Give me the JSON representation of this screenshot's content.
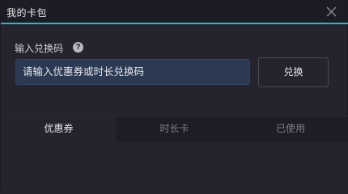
{
  "window": {
    "title": "我的卡包"
  },
  "redeem": {
    "label": "输入兑换码",
    "input_placeholder": "请输入优惠券或时长兑换码",
    "button_label": "兑换"
  },
  "tabs": [
    {
      "label": "优惠券",
      "active": true
    },
    {
      "label": "时长卡",
      "active": false
    },
    {
      "label": "已使用",
      "active": false
    }
  ],
  "icons": {
    "close": "close-icon",
    "help": "help-icon"
  },
  "colors": {
    "accent": "#2fb5c8",
    "input_bg": "#2b3a52",
    "window_bg": "#24232e"
  }
}
